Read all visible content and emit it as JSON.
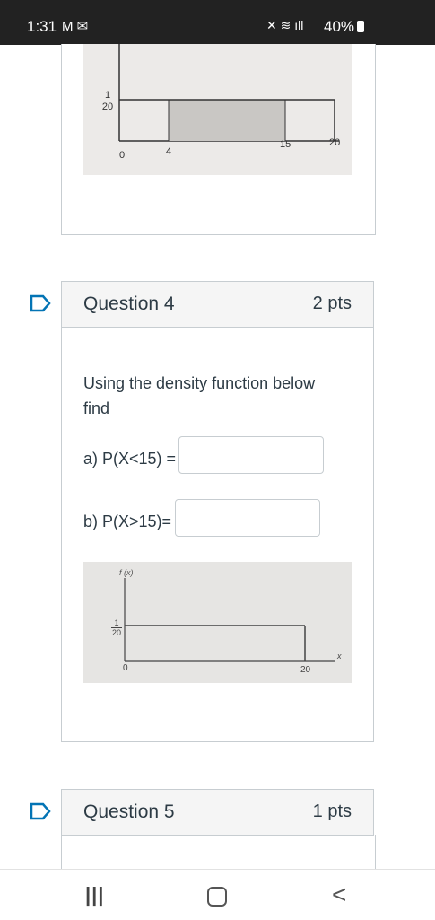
{
  "status_bar": {
    "time": "1:31",
    "left_icons": "M ✉",
    "right_icons": "✕ ≋ ıll",
    "battery": "40%"
  },
  "prev_graph": {
    "y_tick": "1/20",
    "y_tick_num": "1",
    "y_tick_den": "20",
    "x_ticks": [
      "0",
      "4",
      "15",
      "20"
    ]
  },
  "question4": {
    "title": "Question 4",
    "points": "2 pts",
    "prompt": "Using the density function below find",
    "part_a_label": "a)  P(X<15) =",
    "part_b_label": "b) P(X>15)=",
    "part_a_value": "",
    "part_b_value": "",
    "graph": {
      "y_axis_label": "f (x)",
      "y_tick_num": "1",
      "y_tick_den": "20",
      "x_axis_label": "x",
      "x_ticks": [
        "0",
        "20"
      ]
    }
  },
  "question5": {
    "title": "Question 5",
    "points": "1 pts"
  },
  "nav": {
    "recent": "|||",
    "home": "○",
    "back": "<"
  },
  "colors": {
    "accent": "#0374b5",
    "text": "#2d3b45",
    "border": "#c7cdd1",
    "header_bg": "#f5f5f5"
  }
}
